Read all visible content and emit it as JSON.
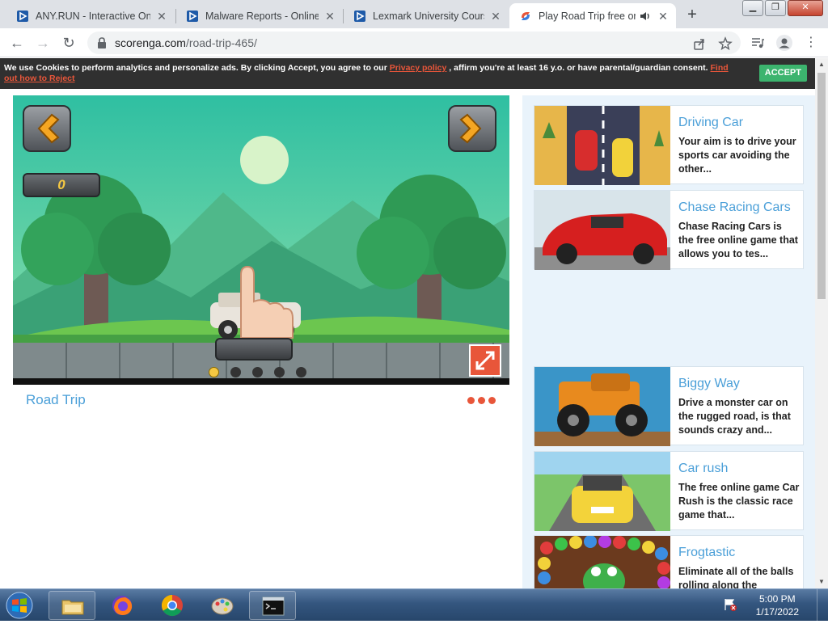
{
  "browser": {
    "tabs": [
      {
        "title": "ANY.RUN - Interactive Onli",
        "active": false
      },
      {
        "title": "Malware Reports - Online M",
        "active": false
      },
      {
        "title": "Lexmark University Course",
        "active": false
      },
      {
        "title": "Play Road Trip free onl",
        "active": true
      }
    ],
    "url_host": "scorenga.com",
    "url_path": "/road-trip-465/"
  },
  "cookie": {
    "text_before": "We use Cookies to perform analytics and personalize ads. By clicking Accept, you agree to our ",
    "privacy_link": "Privacy policy",
    "text_after": " , affirm you're at least 16 y.o. or have parental/guardian consent. ",
    "reject_link": "Find out how to Reject",
    "accept_label": "ACCEPT"
  },
  "game": {
    "title": "Road Trip",
    "score": "0"
  },
  "sidebar": {
    "cards": [
      {
        "title": "Driving Car",
        "desc": "Your aim is to drive your sports car avoiding the other..."
      },
      {
        "title": "Chase Racing Cars",
        "desc": "Chase Racing Cars is the free online game that allows you to tes..."
      },
      {
        "title": "Biggy Way",
        "desc": "Drive a monster car on the rugged road, is that sounds crazy and..."
      },
      {
        "title": "Car rush",
        "desc": "The free online game Car Rush is the classic race game that..."
      },
      {
        "title": "Frogtastic",
        "desc": "Eliminate all of the balls rolling along the"
      }
    ]
  },
  "taskbar": {
    "time": "5:00 PM",
    "date": "1/17/2022"
  },
  "colors": {
    "link": "#4a9fd8",
    "accent_red": "#e8563a",
    "accept_green": "#3cb46e"
  }
}
